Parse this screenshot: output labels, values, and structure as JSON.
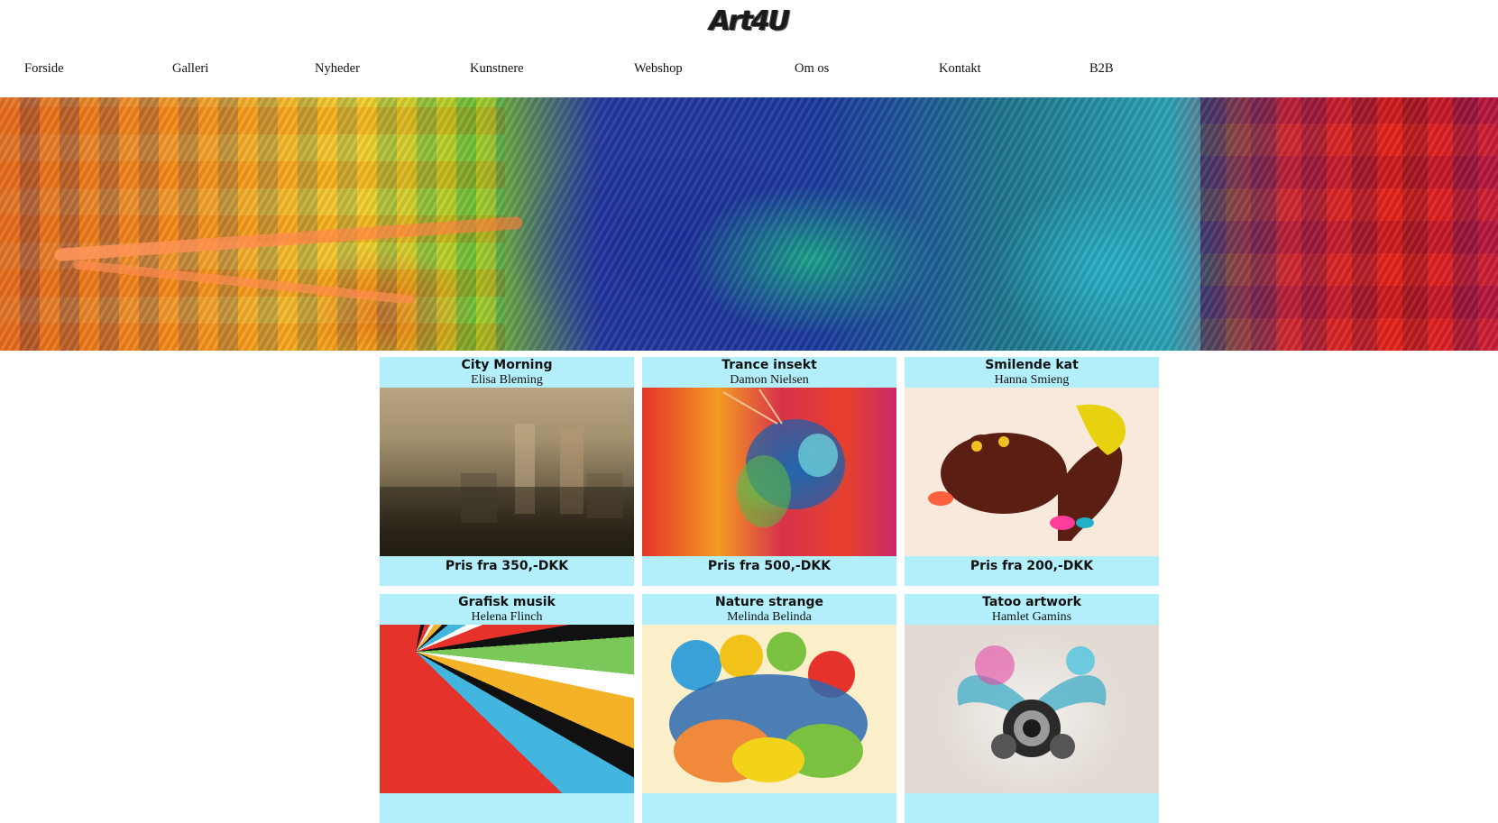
{
  "site": {
    "logo": "Art4U"
  },
  "nav": [
    {
      "label": "Forside"
    },
    {
      "label": "Galleri"
    },
    {
      "label": "Nyheder"
    },
    {
      "label": "Kunstnere"
    },
    {
      "label": "Webshop"
    },
    {
      "label": "Om os"
    },
    {
      "label": "Kontakt"
    },
    {
      "label": "B2B"
    }
  ],
  "products": [
    {
      "title": "City Morning",
      "artist": "Elisa Bleming",
      "price": "Pris fra 350,-DKK"
    },
    {
      "title": "Trance insekt",
      "artist": "Damon Nielsen",
      "price": "Pris fra 500,-DKK"
    },
    {
      "title": "Smilende kat",
      "artist": "Hanna Smieng",
      "price": "Pris fra 200,-DKK"
    },
    {
      "title": "Grafisk musik",
      "artist": "Helena Flinch",
      "price": ""
    },
    {
      "title": "Nature strange",
      "artist": "Melinda Belinda",
      "price": ""
    },
    {
      "title": "Tatoo artwork",
      "artist": "Hamlet Gamins",
      "price": ""
    }
  ],
  "colors": {
    "card_bg": "#b3effa",
    "text": "#111111"
  }
}
